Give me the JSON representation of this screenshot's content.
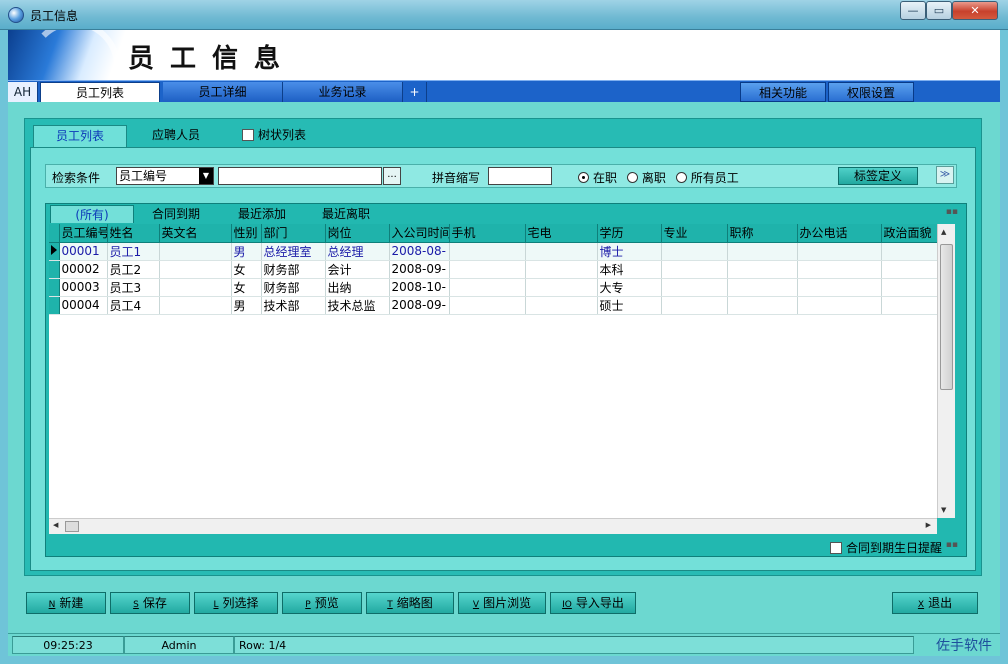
{
  "window": {
    "title": "员工信息",
    "min": "—",
    "max": "▭",
    "close": "✕"
  },
  "banner": {
    "title": "员工信息"
  },
  "topbar": {
    "first": "AH",
    "tabs": [
      "员工列表",
      "员工详细",
      "业务记录",
      "+"
    ],
    "right": [
      "相关功能",
      "权限设置"
    ]
  },
  "subtabs": {
    "list": "员工列表",
    "recruit": "应聘人员",
    "tree": "树状列表"
  },
  "search": {
    "label": "检索条件",
    "field_value": "员工编号",
    "dots": "...",
    "pinyin_label": "拼音缩写",
    "radios": [
      "在职",
      "离职",
      "所有员工"
    ],
    "tag_button": "标签定义"
  },
  "grid": {
    "tabs": [
      "(所有)",
      "合同到期",
      "最近添加",
      "最近离职"
    ],
    "columns": [
      "员工编号",
      "姓名",
      "英文名",
      "性别",
      "部门",
      "岗位",
      "入公司时间",
      "手机",
      "宅电",
      "学历",
      "专业",
      "职称",
      "办公电话",
      "政治面貌"
    ],
    "rows": [
      [
        "00001",
        "员工1",
        "",
        "男",
        "总经理室",
        "总经理",
        "2008-08-",
        "",
        "",
        "博士",
        "",
        "",
        "",
        ""
      ],
      [
        "00002",
        "员工2",
        "",
        "女",
        "财务部",
        "会计",
        "2008-09-",
        "",
        "",
        "本科",
        "",
        "",
        "",
        ""
      ],
      [
        "00003",
        "员工3",
        "",
        "女",
        "财务部",
        "出纳",
        "2008-10-",
        "",
        "",
        "大专",
        "",
        "",
        "",
        ""
      ],
      [
        "00004",
        "员工4",
        "",
        "男",
        "技术部",
        "技术总监",
        "2008-09-",
        "",
        "",
        "硕士",
        "",
        "",
        "",
        ""
      ]
    ],
    "reminder": "合同到期生日提醒"
  },
  "buttons": [
    {
      "key": "N",
      "label": "新建"
    },
    {
      "key": "S",
      "label": "保存"
    },
    {
      "key": "L",
      "label": "列选择"
    },
    {
      "key": "P",
      "label": "预览"
    },
    {
      "key": "T",
      "label": "缩略图"
    },
    {
      "key": "V",
      "label": "图片浏览"
    },
    {
      "key": "IO",
      "label": "导入导出"
    },
    {
      "key": "X",
      "label": "退出"
    }
  ],
  "status": {
    "time": "09:25:23",
    "user": "Admin",
    "row": "Row: 1/4",
    "brand": "佐手软件"
  },
  "colors": {
    "accent_blue": "#1c63c9",
    "teal": "#27bbb4",
    "current_row_text": "#1a1aa8"
  }
}
